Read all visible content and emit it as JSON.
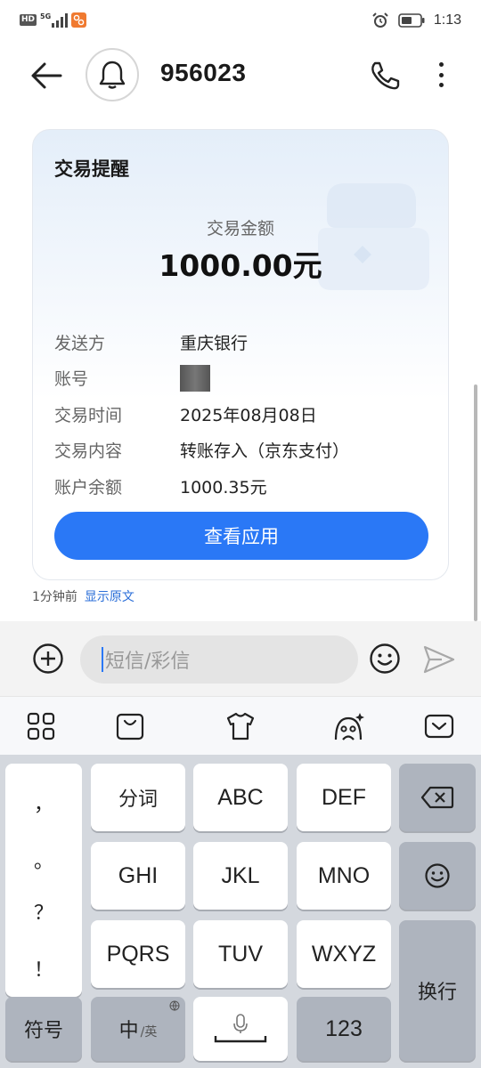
{
  "status_bar": {
    "hd": "HD",
    "network": "5G",
    "time": "1:13",
    "icons": [
      "hd-icon",
      "signal-icon",
      "app-notification-icon",
      "alarm-icon",
      "battery-icon"
    ]
  },
  "header": {
    "contact": "956023",
    "icons": [
      "back-arrow-icon",
      "bell-icon",
      "phone-icon",
      "more-icon"
    ]
  },
  "card": {
    "title": "交易提醒",
    "amount_label": "交易金额",
    "amount_value": "1000.00元",
    "rows": [
      {
        "key": "发送方",
        "value": "重庆银行"
      },
      {
        "key": "账号",
        "value": ""
      },
      {
        "key": "交易时间",
        "value": "2025年08月08日"
      },
      {
        "key": "交易内容",
        "value": "转账存入（京东支付）"
      },
      {
        "key": "账户余额",
        "value": "1000.35元"
      }
    ],
    "button": "查看应用",
    "accent": "#2a78f6"
  },
  "message_meta": {
    "time": "1分钟前",
    "show_original": "显示原文"
  },
  "compose": {
    "placeholder": "短信/彩信",
    "icons": [
      "add-icon",
      "emoji-icon",
      "send-icon"
    ]
  },
  "keyboard_toolbar": {
    "icons": [
      "grid-apps-icon",
      "shopping-bag-icon",
      "tshirt-icon",
      "ai-assistant-icon",
      "collapse-keyboard-icon"
    ]
  },
  "keyboard": {
    "punctuation": [
      "，",
      "。",
      "？",
      "！"
    ],
    "row1": [
      "分词",
      "ABC",
      "DEF"
    ],
    "row2": [
      "GHI",
      "JKL",
      "MNO"
    ],
    "row3": [
      "PQRS",
      "TUV",
      "WXYZ"
    ],
    "symbols": "符号",
    "lang_main": "中",
    "lang_alt": "/英",
    "numbers": "123",
    "enter": "换行"
  }
}
